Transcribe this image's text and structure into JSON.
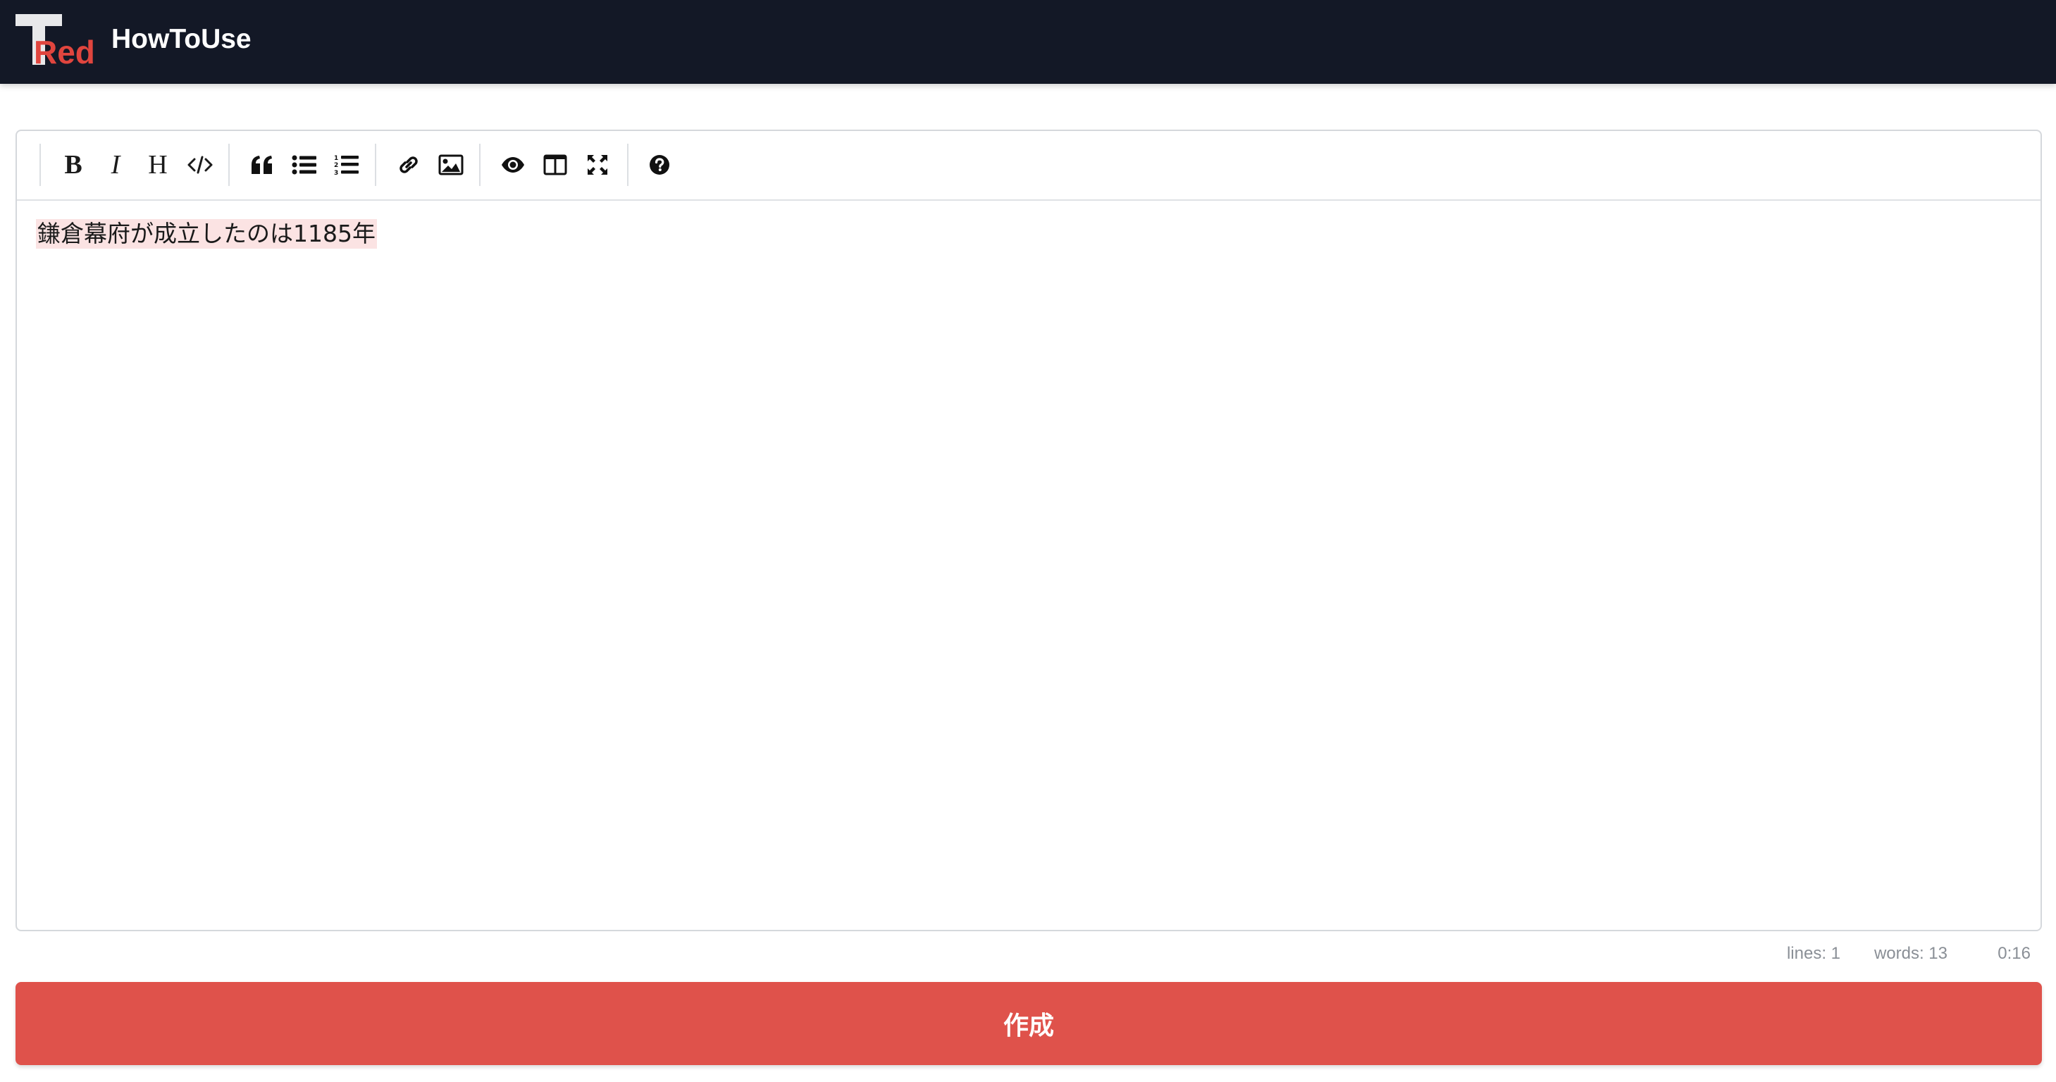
{
  "header": {
    "logo": {
      "letter": "T",
      "word": "Red"
    },
    "title": "HowToUse"
  },
  "toolbar": {
    "buttons": [
      {
        "name": "bold",
        "icon": "bold-icon",
        "glyph": "B"
      },
      {
        "name": "italic",
        "icon": "italic-icon",
        "glyph": "I"
      },
      {
        "name": "heading",
        "icon": "heading-icon",
        "glyph": "H"
      },
      {
        "name": "code",
        "icon": "code-icon",
        "glyph": "</>"
      },
      {
        "name": "quote",
        "icon": "quote-icon"
      },
      {
        "name": "unordered-list",
        "icon": "bullet-list-icon"
      },
      {
        "name": "ordered-list",
        "icon": "numbered-list-icon"
      },
      {
        "name": "link",
        "icon": "link-icon"
      },
      {
        "name": "image",
        "icon": "image-icon"
      },
      {
        "name": "preview",
        "icon": "eye-icon"
      },
      {
        "name": "side-by-side",
        "icon": "columns-icon"
      },
      {
        "name": "fullscreen",
        "icon": "fullscreen-icon"
      },
      {
        "name": "guide",
        "icon": "question-icon"
      }
    ]
  },
  "editor": {
    "content": "鎌倉幕府が成立したのは1185年"
  },
  "status": {
    "lines": "lines: 1",
    "words": "words: 13",
    "time": "0:16"
  },
  "submit_label": "作成",
  "colors": {
    "header_bg": "#131826",
    "accent": "#df524b",
    "highlight": "#fbe3e3"
  }
}
